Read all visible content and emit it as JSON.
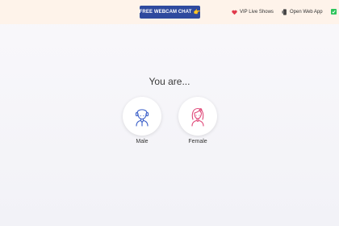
{
  "header": {
    "cta_label": "FREE WEBCAM CHAT",
    "cta_emoji": "👉",
    "vip_label": "VIP Live Shows",
    "open_app_label": "Open Web App"
  },
  "main": {
    "title": "You are...",
    "options": [
      {
        "label": "Male",
        "icon": "male-avatar-icon"
      },
      {
        "label": "Female",
        "icon": "female-avatar-icon"
      }
    ]
  },
  "colors": {
    "cta_bg": "#2e4a9e",
    "header_bg": "#fef3ea",
    "male_icon": "#3b5fc9",
    "female_icon": "#e04a7a",
    "heart": "#e03a4c",
    "check": "#2cc45b"
  }
}
